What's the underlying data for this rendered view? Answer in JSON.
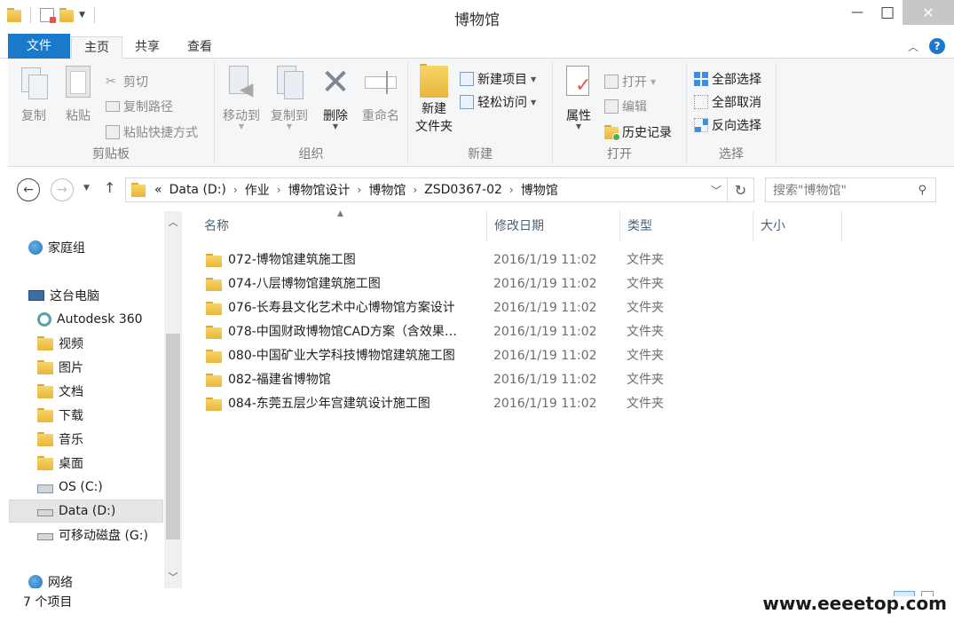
{
  "window": {
    "title": "博物馆",
    "minimize_glyph": "—",
    "maximize_glyph": "□",
    "close_glyph": "✕"
  },
  "tabs": {
    "file": "文件",
    "home": "主页",
    "share": "共享",
    "view": "查看"
  },
  "ribbon": {
    "clipboard": {
      "label": "剪贴板",
      "copy": "复制",
      "paste": "粘贴",
      "cut": "剪切",
      "copy_path": "复制路径",
      "paste_shortcut": "粘贴快捷方式"
    },
    "organize": {
      "label": "组织",
      "move_to": "移动到",
      "copy_to": "复制到",
      "delete": "删除",
      "rename": "重命名"
    },
    "new": {
      "label": "新建",
      "new_folder_1": "新建",
      "new_folder_2": "文件夹",
      "new_item": "新建项目",
      "easy_access": "轻松访问"
    },
    "open": {
      "label": "打开",
      "properties": "属性",
      "open": "打开",
      "edit": "编辑",
      "history": "历史记录"
    },
    "select": {
      "label": "选择",
      "select_all": "全部选择",
      "select_none": "全部取消",
      "invert": "反向选择"
    }
  },
  "address": {
    "overflow": "«",
    "segments": [
      "Data (D:)",
      "作业",
      "博物馆设计",
      "博物馆",
      "ZSD0367-02",
      "博物馆"
    ]
  },
  "search": {
    "placeholder": "搜索\"博物馆\""
  },
  "navpane": {
    "homegroup": "家庭组",
    "this_pc": "这台电脑",
    "items": [
      "Autodesk 360",
      "视频",
      "图片",
      "文档",
      "下载",
      "音乐",
      "桌面",
      "OS (C:)",
      "Data (D:)",
      "可移动磁盘 (G:)"
    ],
    "network": "网络"
  },
  "columns": {
    "name": "名称",
    "date": "修改日期",
    "type": "类型",
    "size": "大小"
  },
  "files": [
    {
      "name": "072-博物馆建筑施工图",
      "date": "2016/1/19 11:02",
      "type": "文件夹"
    },
    {
      "name": "074-八层博物馆建筑施工图",
      "date": "2016/1/19 11:02",
      "type": "文件夹"
    },
    {
      "name": "076-长寿县文化艺术中心博物馆方案设计",
      "date": "2016/1/19 11:02",
      "type": "文件夹"
    },
    {
      "name": "078-中国财政博物馆CAD方案（含效果…",
      "date": "2016/1/19 11:02",
      "type": "文件夹"
    },
    {
      "name": "080-中国矿业大学科技博物馆建筑施工图",
      "date": "2016/1/19 11:02",
      "type": "文件夹"
    },
    {
      "name": "082-福建省博物馆",
      "date": "2016/1/19 11:02",
      "type": "文件夹"
    },
    {
      "name": "084-东莞五层少年宫建筑设计施工图",
      "date": "2016/1/19 11:02",
      "type": "文件夹"
    }
  ],
  "status": {
    "count": "7 个项目"
  },
  "watermark": "www.eeeetop.com",
  "colors": {
    "accent": "#1979ca",
    "folder": "#f0c451",
    "ribbon_bg": "#f5f6f7"
  }
}
